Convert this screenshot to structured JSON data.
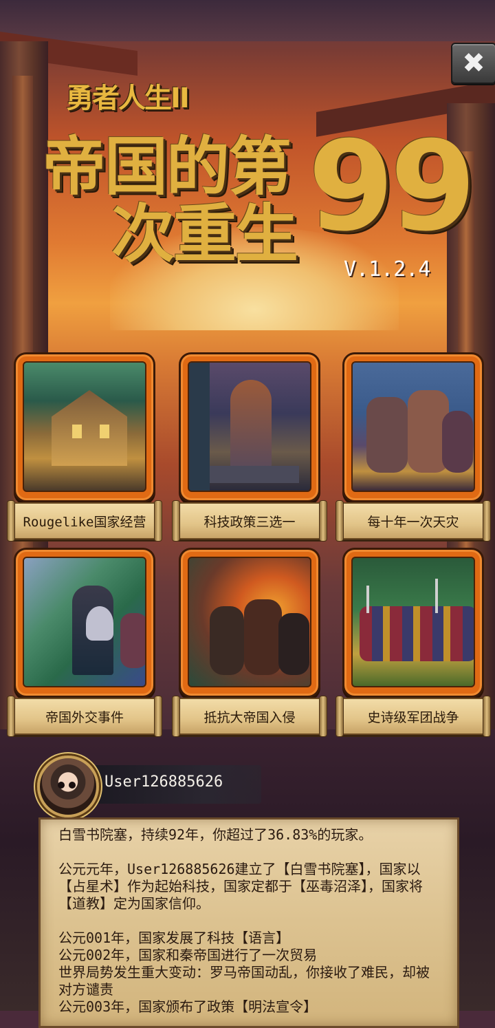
{
  "header": {
    "subtitle": "勇者人生II",
    "title_line1": "帝国的第",
    "title_line2": "次重生",
    "title_number": "99",
    "version": "V.1.2.4",
    "close_icon": "close-icon"
  },
  "features": [
    {
      "label": "Rougelike国家经营",
      "art": "village-scene"
    },
    {
      "label": "科技政策三选一",
      "art": "statue-scene"
    },
    {
      "label": "每十年一次天灾",
      "art": "battle-scene"
    },
    {
      "label": "帝国外交事件",
      "art": "knight-scene"
    },
    {
      "label": "抵抗大帝国入侵",
      "art": "fire-scene"
    },
    {
      "label": "史诗级军团战争",
      "art": "army-scene"
    }
  ],
  "user": {
    "name": "User126885626",
    "avatar_icon": "avatar"
  },
  "log": {
    "summary": "白雪书院塞，持续92年，你超过了36.83%的玩家。",
    "founding": "公元元年，User126885626建立了【白雪书院塞】，国家以【占星术】作为起始科技，国家定都于【巫毒沼泽】，国家将【道教】定为国家信仰。",
    "entries": [
      "公元001年，国家发展了科技【语言】",
      "公元002年，国家和秦帝国进行了一次贸易",
      "世界局势发生重大变动：罗马帝国动乱，你接收了难民，却被对方谴责",
      "公元003年，国家颁布了政策【明法宣令】"
    ]
  },
  "colors": {
    "card_frame": "#e06a14",
    "title_gold": "#e0b040",
    "parchment": "#e8d2a8"
  }
}
